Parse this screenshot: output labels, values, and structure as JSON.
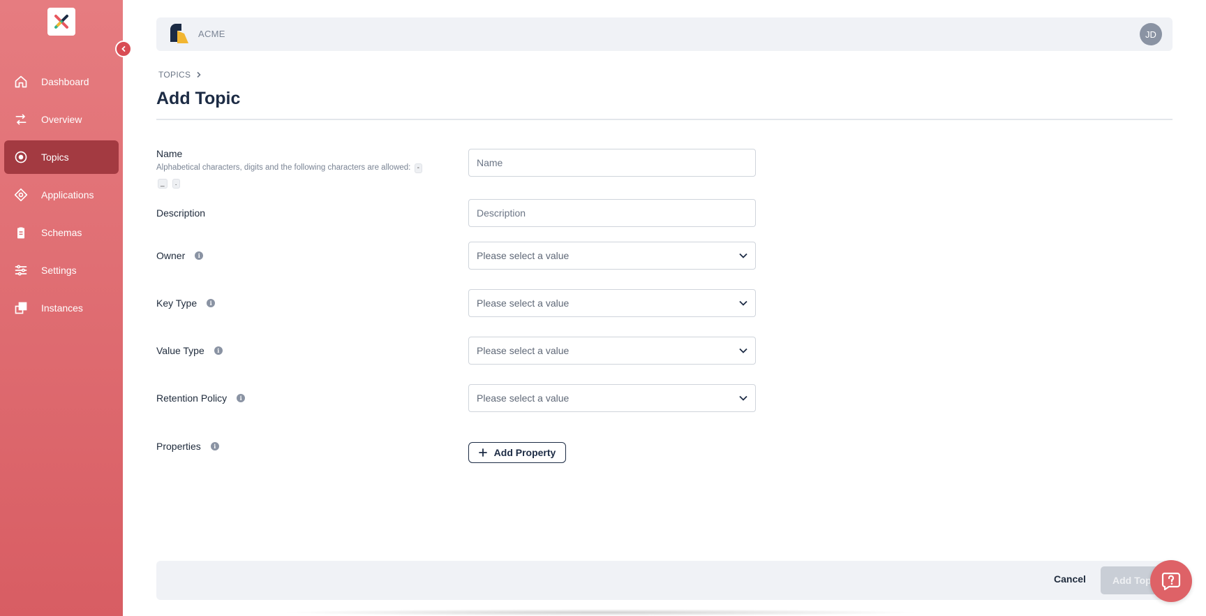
{
  "sidebar": {
    "items": [
      {
        "label": "Dashboard",
        "icon": "home-icon"
      },
      {
        "label": "Overview",
        "icon": "arrows-icon"
      },
      {
        "label": "Topics",
        "icon": "target-icon",
        "active": true
      },
      {
        "label": "Applications",
        "icon": "diamond-icon"
      },
      {
        "label": "Schemas",
        "icon": "clipboard-icon"
      },
      {
        "label": "Settings",
        "icon": "sliders-icon"
      },
      {
        "label": "Instances",
        "icon": "instances-icon"
      }
    ]
  },
  "header": {
    "org_name": "ACME",
    "avatar_initials": "JD"
  },
  "breadcrumb": {
    "root": "TOPICS"
  },
  "page": {
    "title": "Add Topic"
  },
  "form": {
    "name": {
      "label": "Name",
      "hint": "Alphabetical characters, digits and the following characters are allowed:",
      "allowed_chars": [
        "-",
        "_",
        "."
      ],
      "placeholder": "Name",
      "value": ""
    },
    "description": {
      "label": "Description",
      "placeholder": "Description",
      "value": ""
    },
    "owner": {
      "label": "Owner",
      "value": "Please select a value"
    },
    "key_type": {
      "label": "Key Type",
      "value": "Please select a value"
    },
    "value_type": {
      "label": "Value Type",
      "value": "Please select a value"
    },
    "retention_policy": {
      "label": "Retention Policy",
      "value": "Please select a value"
    },
    "properties": {
      "label": "Properties",
      "add_button": "Add Property"
    }
  },
  "footer": {
    "cancel_label": "Cancel",
    "submit_label": "Add Topic"
  },
  "colors": {
    "sidebar_top": "#e67c80",
    "sidebar_bottom": "#d85d63",
    "sidebar_active": "#a33a41",
    "title": "#1c2b44",
    "help_button": "#de6267"
  }
}
